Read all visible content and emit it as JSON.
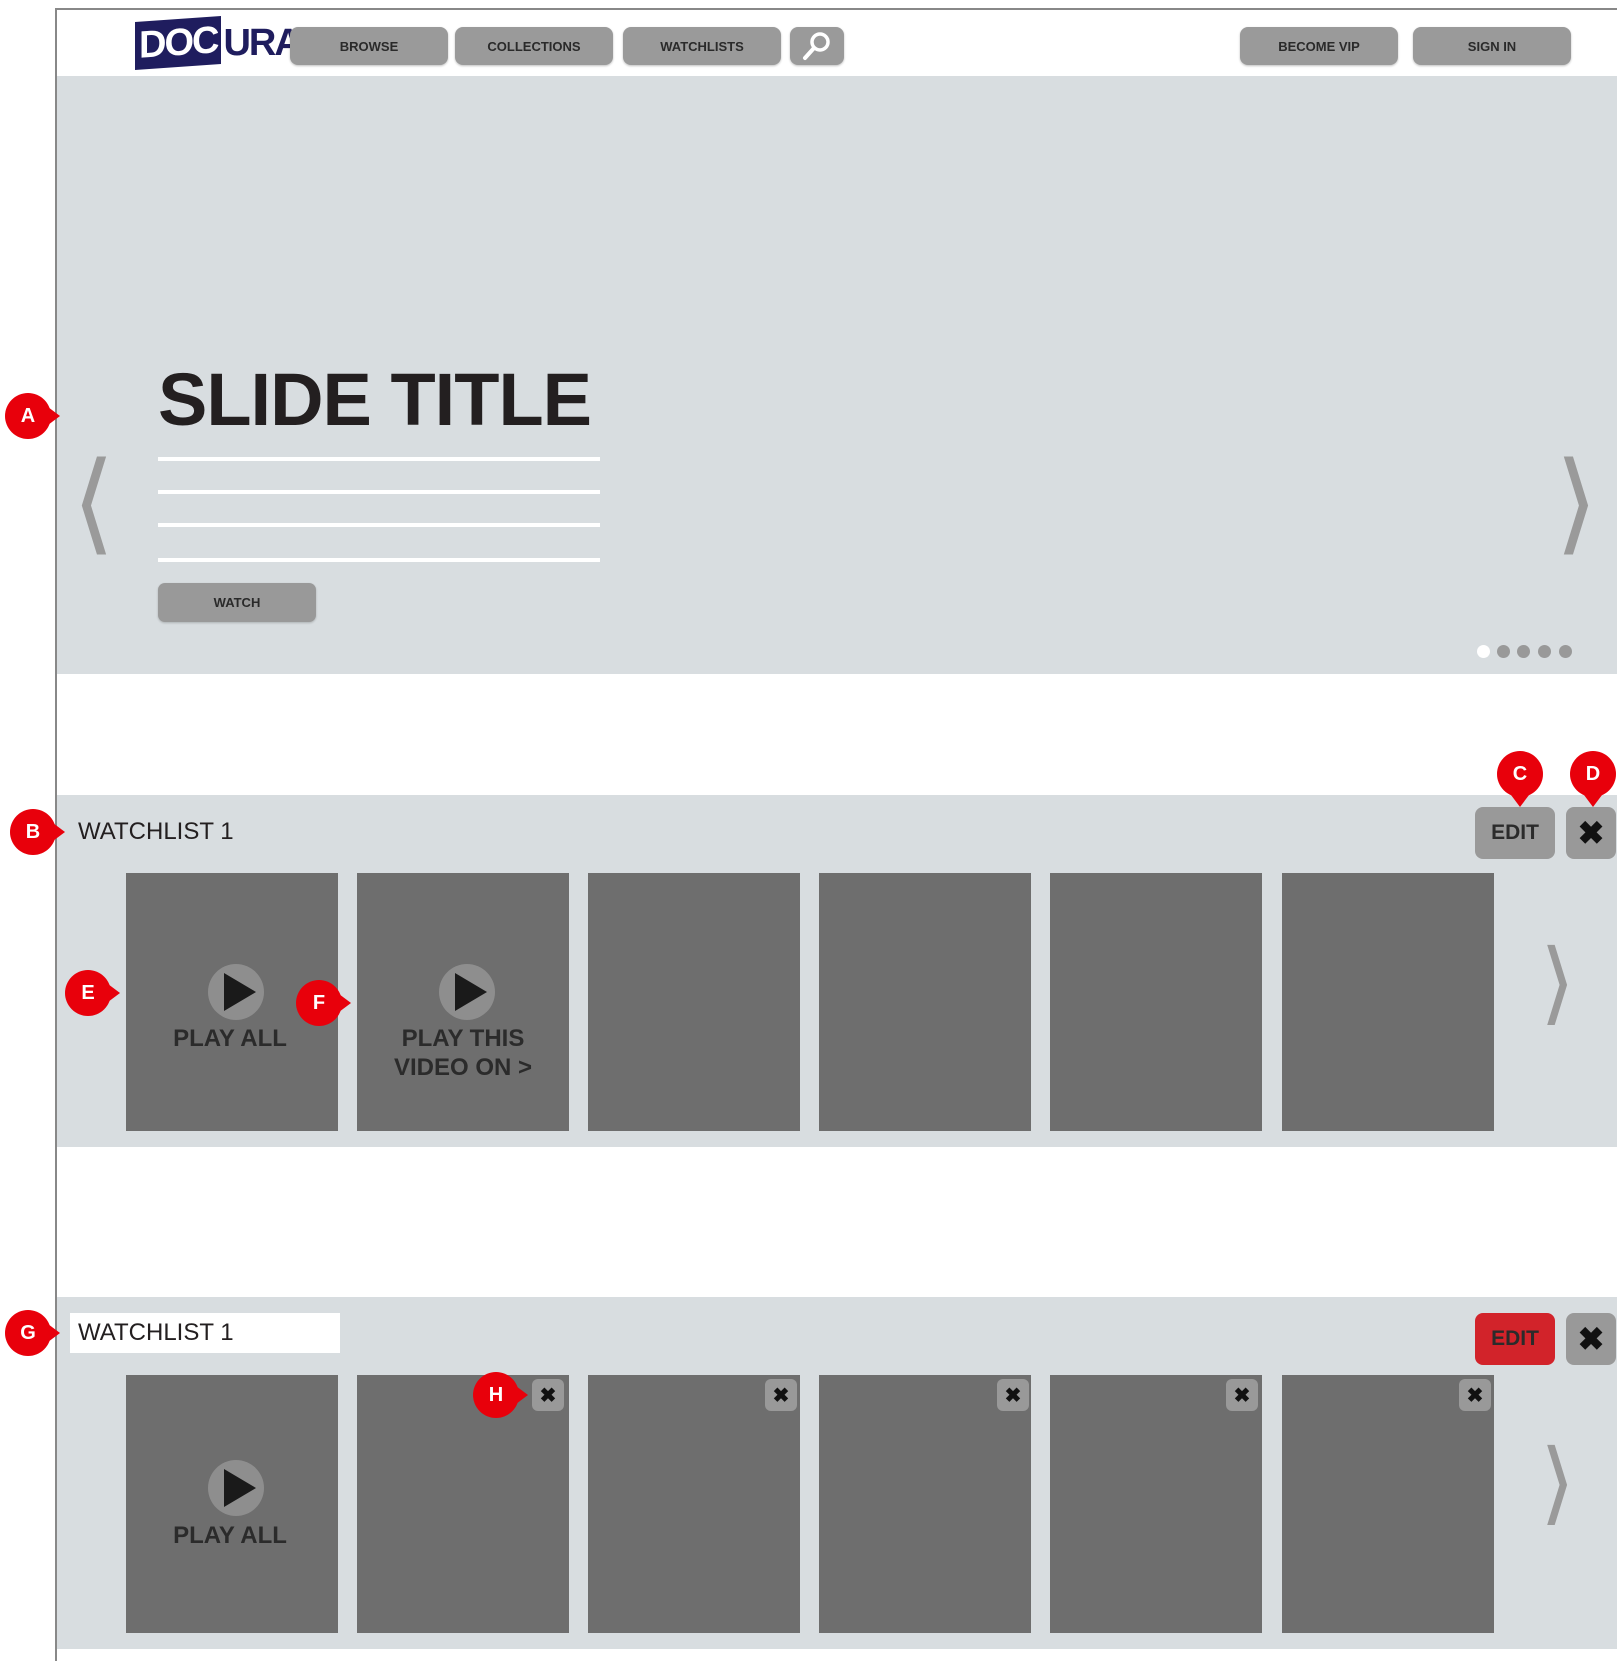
{
  "header": {
    "logo": {
      "box_text": "DOC",
      "rest_text": "URAMA"
    },
    "nav": [
      {
        "label": "BROWSE"
      },
      {
        "label": "COLLECTIONS"
      },
      {
        "label": "WATCHLISTS"
      }
    ],
    "search_icon": "search-icon",
    "right": [
      {
        "label": "BECOME VIP"
      },
      {
        "label": "SIGN IN"
      }
    ]
  },
  "hero": {
    "title": "SLIDE TITLE",
    "watch_label": "WATCH",
    "prev_glyph": "⟨",
    "next_glyph": "⟩",
    "dots_total": 5,
    "active_dot": 1
  },
  "watchlist_view": {
    "title": "WATCHLIST 1",
    "edit_label": "EDIT",
    "close_glyph": "✖",
    "tiles": [
      {
        "label": "PLAY ALL"
      },
      {
        "label_line1": "PLAY THIS",
        "label_line2": "VIDEO ON >"
      },
      {},
      {},
      {},
      {}
    ],
    "next_glyph": "⟩"
  },
  "watchlist_edit": {
    "title_value": "WATCHLIST 1",
    "edit_label": "EDIT",
    "close_glyph": "✖",
    "play_all_label": "PLAY ALL",
    "remove_glyph": "✖",
    "next_glyph": "⟩"
  },
  "annotations": [
    "A",
    "B",
    "C",
    "D",
    "E",
    "F",
    "G",
    "H"
  ],
  "colors": {
    "brand": "#1f1d5e",
    "panel_bg": "#d8dde0",
    "button_gray": "#999999",
    "tile_gray": "#6e6e6e",
    "edit_active": "#d2232a",
    "marker_red": "#e8000b"
  }
}
